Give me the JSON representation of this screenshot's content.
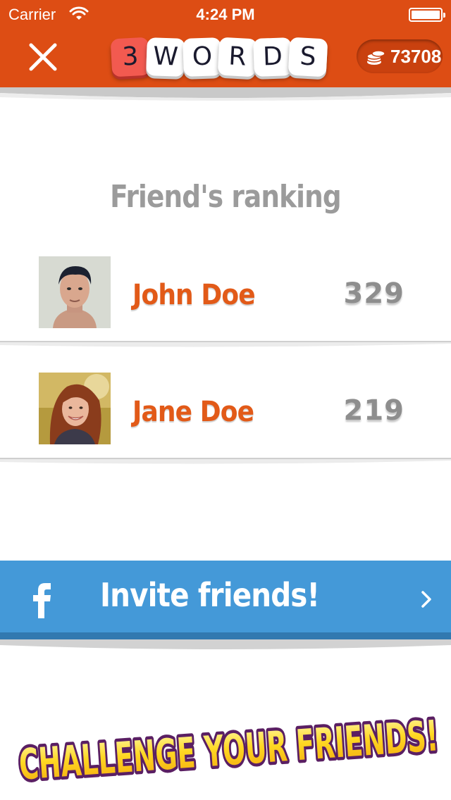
{
  "status_bar": {
    "carrier": "Carrier",
    "time": "4:24 PM"
  },
  "header": {
    "logo_letters": [
      "3",
      "W",
      "O",
      "R",
      "D",
      "S"
    ],
    "coins": "73708"
  },
  "ranking": {
    "title": "Friend's ranking",
    "friends": [
      {
        "name": "John Doe",
        "score": "329"
      },
      {
        "name": "Jane Doe",
        "score": "219"
      }
    ]
  },
  "invite": {
    "label": "Invite friends!"
  },
  "banner": {
    "text": "CHALLENGE YOUR FRIENDS!"
  },
  "colors": {
    "header": "#dd4d14",
    "accent_name": "#e25a18",
    "invite": "#4499d8",
    "score": "#8e8e8e"
  },
  "icons": [
    "wifi-icon",
    "battery-icon",
    "close-icon",
    "coins-icon",
    "facebook-icon",
    "chevron-right-icon"
  ]
}
